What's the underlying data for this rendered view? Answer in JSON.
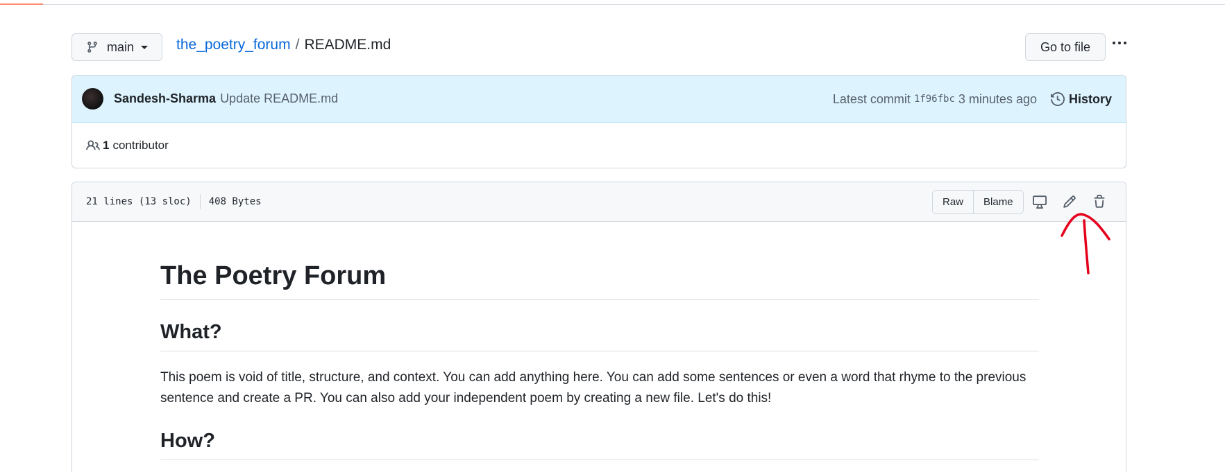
{
  "branch": {
    "name": "main"
  },
  "breadcrumb": {
    "repo": "the_poetry_forum",
    "separator": "/",
    "file": "README.md"
  },
  "actions": {
    "go_to_file": "Go to file"
  },
  "commit": {
    "author": "Sandesh-Sharma",
    "message": "Update README.md",
    "latest_label": "Latest commit",
    "sha": "1f96fbc",
    "time": "3 minutes ago",
    "history_label": "History"
  },
  "contributors": {
    "count": "1",
    "label": "contributor"
  },
  "file_info": {
    "lines": "21 lines (13 sloc)",
    "size": "408 Bytes",
    "raw_label": "Raw",
    "blame_label": "Blame"
  },
  "readme": {
    "title": "The Poetry Forum",
    "h2_what": "What?",
    "paragraph": "This poem is void of title, structure, and context. You can add anything here. You can add some sentences or even a word that rhyme to the previous sentence and create a PR. You can also add your independent poem by creating a new file. Let's do this!",
    "h2_how": "How?"
  },
  "colors": {
    "link": "#0969da",
    "annotation": "#e5001b",
    "commit_bg": "#ddf4ff"
  }
}
